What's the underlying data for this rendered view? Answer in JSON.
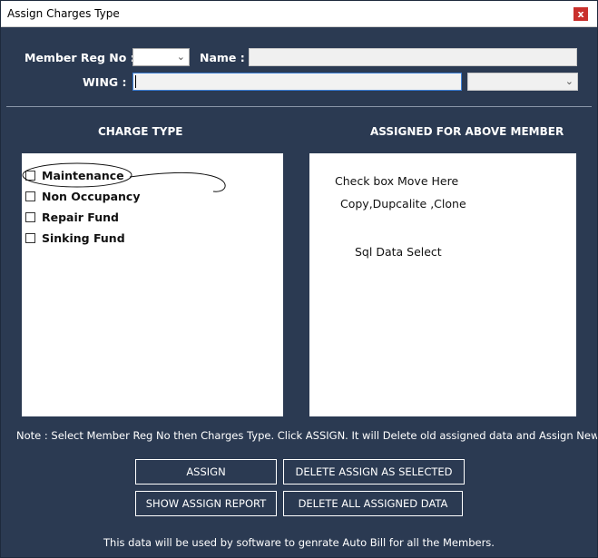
{
  "window": {
    "title": "Assign Charges Type",
    "close_glyph": "x"
  },
  "form": {
    "member_reg_label": "Member Reg No :",
    "member_reg_value": "",
    "name_label": "Name :",
    "name_value": "",
    "wing_label": "WING :",
    "wing_value": "",
    "wing_select_value": ""
  },
  "sections": {
    "charge_type_title": "CHARGE TYPE",
    "assigned_title": "ASSIGNED FOR ABOVE MEMBER"
  },
  "charge_types": [
    {
      "label": "Maintenance",
      "checked": false
    },
    {
      "label": "Non Occupancy",
      "checked": false
    },
    {
      "label": "Repair Fund",
      "checked": false
    },
    {
      "label": "Sinking Fund",
      "checked": false
    }
  ],
  "assigned_notes": {
    "line1": "Check box Move Here",
    "line2": "Copy,Dupcalite ,Clone",
    "line3": "Sql Data Select"
  },
  "note": "Note : Select Member Reg No then Charges Type. Click ASSIGN. It will Delete old assigned data and Assign New Data",
  "buttons": {
    "assign": "ASSIGN",
    "delete_selected": "DELETE ASSIGN AS SELECTED",
    "show_report": "SHOW ASSIGN REPORT",
    "delete_all": "DELETE ALL ASSIGNED DATA"
  },
  "footer": "This data will be used by software to genrate Auto Bill for all the Members.",
  "icons": {
    "dropdown": "chevron-down-icon",
    "checkbox": "checkbox-icon",
    "close": "close-icon"
  },
  "colors": {
    "background": "#2b3a52",
    "close_button": "#c9302c",
    "panel": "#ffffff"
  }
}
